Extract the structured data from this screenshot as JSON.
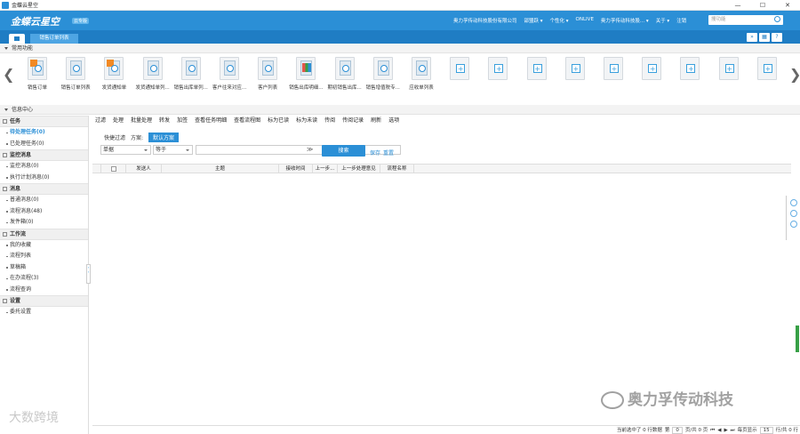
{
  "window": {
    "title": "金蝶云星空",
    "controls": [
      "—",
      "☐",
      "✕"
    ]
  },
  "header": {
    "brand": "金蝶云星空",
    "badge": "云专版",
    "nav": [
      "奥力孚传动科技股份有限公司",
      "邵盟跃 ▾",
      "个性化 ▾",
      "ONLIVE",
      "奥力孚传动科技股... ▾",
      "关于 ▾",
      "注销"
    ],
    "search_placeholder": "搜功能"
  },
  "tabs": {
    "home_icon": "home-icon",
    "active_tab": "销售订单列表",
    "right_buttons": [
      "»",
      "▦",
      "?"
    ]
  },
  "common": {
    "title": "常用功能",
    "items": [
      {
        "label": "销售订单",
        "icon": "order-edit-icon"
      },
      {
        "label": "销售订单列表",
        "icon": "list-search-icon"
      },
      {
        "label": "发货通知单",
        "icon": "order-edit-icon"
      },
      {
        "label": "发货通知单列...",
        "icon": "list-search-icon"
      },
      {
        "label": "销售出库单列...",
        "icon": "list-search-icon"
      },
      {
        "label": "客户往来对应...",
        "icon": "list-search-icon"
      },
      {
        "label": "客户列表",
        "icon": "list-search-icon"
      },
      {
        "label": "销售出库明细...",
        "icon": "report-chart-icon"
      },
      {
        "label": "期初销售出库...",
        "icon": "list-search-icon"
      },
      {
        "label": "销售增值税专...",
        "icon": "list-search-icon"
      },
      {
        "label": "应收单列表",
        "icon": "list-search-icon"
      },
      {
        "label": "",
        "icon": "add-shortcut-icon"
      },
      {
        "label": "",
        "icon": "add-shortcut-icon"
      },
      {
        "label": "",
        "icon": "add-shortcut-icon"
      },
      {
        "label": "",
        "icon": "add-shortcut-icon"
      },
      {
        "label": "",
        "icon": "add-shortcut-icon"
      },
      {
        "label": "",
        "icon": "add-shortcut-icon"
      },
      {
        "label": "",
        "icon": "add-shortcut-icon"
      },
      {
        "label": "",
        "icon": "add-shortcut-icon"
      },
      {
        "label": "",
        "icon": "add-shortcut-icon"
      }
    ]
  },
  "info": {
    "title": "信息中心"
  },
  "sidebar": {
    "groups": [
      {
        "title": "任务",
        "items": [
          {
            "label": "待处理任务(0)",
            "active": true
          },
          {
            "label": "已处理任务(0)"
          }
        ]
      },
      {
        "title": "监控消息",
        "items": [
          {
            "label": "监控消息(0)"
          },
          {
            "label": "执行计划消息(0)"
          }
        ]
      },
      {
        "title": "消息",
        "items": [
          {
            "label": "普通消息(0)"
          },
          {
            "label": "流程消息(48)"
          },
          {
            "label": "发件箱(0)"
          }
        ]
      },
      {
        "title": "工作流",
        "items": [
          {
            "label": "我的收藏"
          },
          {
            "label": "流程列表"
          },
          {
            "label": "草稿箱"
          },
          {
            "label": "在办流程(3)"
          },
          {
            "label": "流程查询"
          }
        ]
      },
      {
        "title": "设置",
        "items": [
          {
            "label": "委托设置"
          }
        ]
      }
    ]
  },
  "toolbar": [
    "过滤",
    "处理",
    "批量处理",
    "转发",
    "加签",
    "查看任务明细",
    "查看流程图",
    "标为已读",
    "标为未读",
    "传阅",
    "传阅记录",
    "刷新",
    "选项"
  ],
  "scheme": {
    "quick_filter": "快捷过滤",
    "scheme_label": "方案:",
    "default_scheme": "默认方案"
  },
  "filter": {
    "field": "单据",
    "operator": "等于",
    "value": "",
    "expand": "≫",
    "search": "搜索",
    "save": "保存",
    "reset": "重置"
  },
  "grid": {
    "columns": [
      "",
      "发送人",
      "主题",
      "接收时间",
      "上一步...",
      "上一步处理意见",
      "流程名称"
    ]
  },
  "pager": {
    "summary": "当前选中了 0 行数据",
    "page_prefix": "第",
    "page_value": "0",
    "page_suffix": "页/共 0 页",
    "nav": [
      "⏮",
      "◀",
      "▶",
      "⏭"
    ],
    "per_page_label": "每页显示",
    "per_page_value": "15",
    "total": "行/共 0 行"
  },
  "watermarks": {
    "left": "大数跨境",
    "right": "奥力孚传动科技"
  }
}
